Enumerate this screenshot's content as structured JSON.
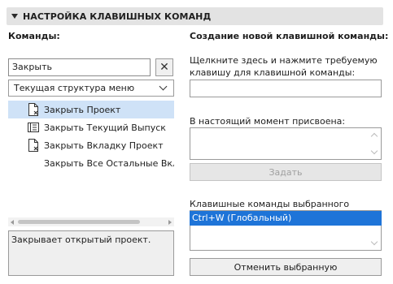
{
  "header": {
    "title": "НАСТРОЙКА КЛАВИШНЫХ КОМАНД"
  },
  "left": {
    "commands_label": "Команды:",
    "search_value": "Закрыть",
    "clear_label": "✕",
    "menu_selector": "Текущая структура меню",
    "commands": [
      {
        "label": "Закрыть Проект",
        "icon": "close-document-icon",
        "selected": true
      },
      {
        "label": "Закрыть Текущий Выпуск",
        "icon": "close-issue-icon",
        "selected": false
      },
      {
        "label": "Закрыть Вкладку Проект",
        "icon": "close-tab-icon",
        "selected": false
      },
      {
        "label": "Закрыть Все Остальные Вкладки",
        "icon": "",
        "selected": false
      }
    ],
    "description": "Закрывает открытый проект."
  },
  "right": {
    "create_label": "Создание новой клавишной команды:",
    "instruction": "Щелкните здесь и нажмите требуемую клавишу для клавишной команды:",
    "shortcut_value": "",
    "assigned_label": "В настоящий момент присвоена:",
    "assign_button": "Задать",
    "selected_shortcuts_label": "Клавишные команды выбранного элемента:",
    "selected_shortcuts": [
      "Ctrl+W (Глобальный)"
    ],
    "remove_button": "Отменить выбранную"
  },
  "colors": {
    "selection": "#1e74d8",
    "list_highlight": "#cfe2f7",
    "header_bg": "#e3e3e3"
  }
}
